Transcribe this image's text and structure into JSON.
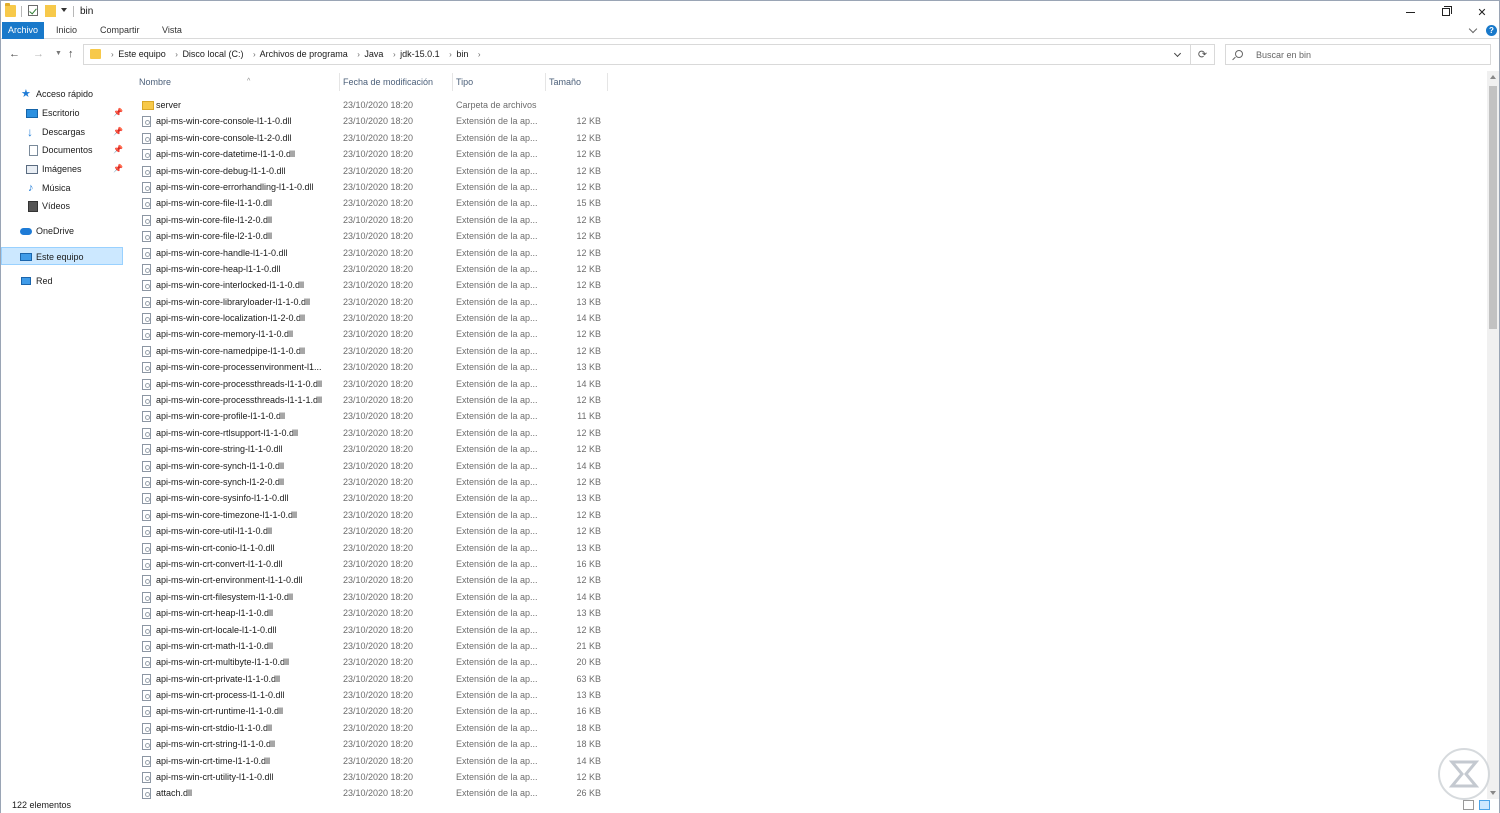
{
  "window": {
    "title": "bin"
  },
  "ribbon": {
    "tabs": [
      "Archivo",
      "Inicio",
      "Compartir",
      "Vista"
    ],
    "help_label": "?"
  },
  "address": {
    "crumbs": [
      "Este equipo",
      "Disco local (C:)",
      "Archivos de programa",
      "Java",
      "jdk-15.0.1",
      "bin"
    ],
    "search_placeholder": "Buscar en bin"
  },
  "nav_pane": {
    "items": [
      {
        "label": "Acceso rápido",
        "icon": "star-icon"
      },
      {
        "label": "Escritorio",
        "icon": "desktop-icon",
        "pinned": true
      },
      {
        "label": "Descargas",
        "icon": "download-icon",
        "pinned": true
      },
      {
        "label": "Documentos",
        "icon": "document-icon",
        "pinned": true
      },
      {
        "label": "Imágenes",
        "icon": "images-icon",
        "pinned": true
      },
      {
        "label": "Música",
        "icon": "music-icon"
      },
      {
        "label": "Vídeos",
        "icon": "video-icon"
      },
      {
        "label": "OneDrive",
        "icon": "cloud-icon"
      },
      {
        "label": "Este equipo",
        "icon": "computer-icon",
        "selected": true
      },
      {
        "label": "Red",
        "icon": "network-icon"
      }
    ]
  },
  "columns": {
    "name": "Nombre",
    "date": "Fecha de modificación",
    "type": "Tipo",
    "size": "Tamaño"
  },
  "files": [
    {
      "name": "server",
      "date": "23/10/2020 18:20",
      "type": "Carpeta de archivos",
      "size": "",
      "folder": true
    },
    {
      "name": "api-ms-win-core-console-l1-1-0.dll",
      "date": "23/10/2020 18:20",
      "type": "Extensión de la ap...",
      "size": "12 KB"
    },
    {
      "name": "api-ms-win-core-console-l1-2-0.dll",
      "date": "23/10/2020 18:20",
      "type": "Extensión de la ap...",
      "size": "12 KB"
    },
    {
      "name": "api-ms-win-core-datetime-l1-1-0.dll",
      "date": "23/10/2020 18:20",
      "type": "Extensión de la ap...",
      "size": "12 KB"
    },
    {
      "name": "api-ms-win-core-debug-l1-1-0.dll",
      "date": "23/10/2020 18:20",
      "type": "Extensión de la ap...",
      "size": "12 KB"
    },
    {
      "name": "api-ms-win-core-errorhandling-l1-1-0.dll",
      "date": "23/10/2020 18:20",
      "type": "Extensión de la ap...",
      "size": "12 KB"
    },
    {
      "name": "api-ms-win-core-file-l1-1-0.dll",
      "date": "23/10/2020 18:20",
      "type": "Extensión de la ap...",
      "size": "15 KB"
    },
    {
      "name": "api-ms-win-core-file-l1-2-0.dll",
      "date": "23/10/2020 18:20",
      "type": "Extensión de la ap...",
      "size": "12 KB"
    },
    {
      "name": "api-ms-win-core-file-l2-1-0.dll",
      "date": "23/10/2020 18:20",
      "type": "Extensión de la ap...",
      "size": "12 KB"
    },
    {
      "name": "api-ms-win-core-handle-l1-1-0.dll",
      "date": "23/10/2020 18:20",
      "type": "Extensión de la ap...",
      "size": "12 KB"
    },
    {
      "name": "api-ms-win-core-heap-l1-1-0.dll",
      "date": "23/10/2020 18:20",
      "type": "Extensión de la ap...",
      "size": "12 KB"
    },
    {
      "name": "api-ms-win-core-interlocked-l1-1-0.dll",
      "date": "23/10/2020 18:20",
      "type": "Extensión de la ap...",
      "size": "12 KB"
    },
    {
      "name": "api-ms-win-core-libraryloader-l1-1-0.dll",
      "date": "23/10/2020 18:20",
      "type": "Extensión de la ap...",
      "size": "13 KB"
    },
    {
      "name": "api-ms-win-core-localization-l1-2-0.dll",
      "date": "23/10/2020 18:20",
      "type": "Extensión de la ap...",
      "size": "14 KB"
    },
    {
      "name": "api-ms-win-core-memory-l1-1-0.dll",
      "date": "23/10/2020 18:20",
      "type": "Extensión de la ap...",
      "size": "12 KB"
    },
    {
      "name": "api-ms-win-core-namedpipe-l1-1-0.dll",
      "date": "23/10/2020 18:20",
      "type": "Extensión de la ap...",
      "size": "12 KB"
    },
    {
      "name": "api-ms-win-core-processenvironment-l1...",
      "date": "23/10/2020 18:20",
      "type": "Extensión de la ap...",
      "size": "13 KB"
    },
    {
      "name": "api-ms-win-core-processthreads-l1-1-0.dll",
      "date": "23/10/2020 18:20",
      "type": "Extensión de la ap...",
      "size": "14 KB"
    },
    {
      "name": "api-ms-win-core-processthreads-l1-1-1.dll",
      "date": "23/10/2020 18:20",
      "type": "Extensión de la ap...",
      "size": "12 KB"
    },
    {
      "name": "api-ms-win-core-profile-l1-1-0.dll",
      "date": "23/10/2020 18:20",
      "type": "Extensión de la ap...",
      "size": "11 KB"
    },
    {
      "name": "api-ms-win-core-rtlsupport-l1-1-0.dll",
      "date": "23/10/2020 18:20",
      "type": "Extensión de la ap...",
      "size": "12 KB"
    },
    {
      "name": "api-ms-win-core-string-l1-1-0.dll",
      "date": "23/10/2020 18:20",
      "type": "Extensión de la ap...",
      "size": "12 KB"
    },
    {
      "name": "api-ms-win-core-synch-l1-1-0.dll",
      "date": "23/10/2020 18:20",
      "type": "Extensión de la ap...",
      "size": "14 KB"
    },
    {
      "name": "api-ms-win-core-synch-l1-2-0.dll",
      "date": "23/10/2020 18:20",
      "type": "Extensión de la ap...",
      "size": "12 KB"
    },
    {
      "name": "api-ms-win-core-sysinfo-l1-1-0.dll",
      "date": "23/10/2020 18:20",
      "type": "Extensión de la ap...",
      "size": "13 KB"
    },
    {
      "name": "api-ms-win-core-timezone-l1-1-0.dll",
      "date": "23/10/2020 18:20",
      "type": "Extensión de la ap...",
      "size": "12 KB"
    },
    {
      "name": "api-ms-win-core-util-l1-1-0.dll",
      "date": "23/10/2020 18:20",
      "type": "Extensión de la ap...",
      "size": "12 KB"
    },
    {
      "name": "api-ms-win-crt-conio-l1-1-0.dll",
      "date": "23/10/2020 18:20",
      "type": "Extensión de la ap...",
      "size": "13 KB"
    },
    {
      "name": "api-ms-win-crt-convert-l1-1-0.dll",
      "date": "23/10/2020 18:20",
      "type": "Extensión de la ap...",
      "size": "16 KB"
    },
    {
      "name": "api-ms-win-crt-environment-l1-1-0.dll",
      "date": "23/10/2020 18:20",
      "type": "Extensión de la ap...",
      "size": "12 KB"
    },
    {
      "name": "api-ms-win-crt-filesystem-l1-1-0.dll",
      "date": "23/10/2020 18:20",
      "type": "Extensión de la ap...",
      "size": "14 KB"
    },
    {
      "name": "api-ms-win-crt-heap-l1-1-0.dll",
      "date": "23/10/2020 18:20",
      "type": "Extensión de la ap...",
      "size": "13 KB"
    },
    {
      "name": "api-ms-win-crt-locale-l1-1-0.dll",
      "date": "23/10/2020 18:20",
      "type": "Extensión de la ap...",
      "size": "12 KB"
    },
    {
      "name": "api-ms-win-crt-math-l1-1-0.dll",
      "date": "23/10/2020 18:20",
      "type": "Extensión de la ap...",
      "size": "21 KB"
    },
    {
      "name": "api-ms-win-crt-multibyte-l1-1-0.dll",
      "date": "23/10/2020 18:20",
      "type": "Extensión de la ap...",
      "size": "20 KB"
    },
    {
      "name": "api-ms-win-crt-private-l1-1-0.dll",
      "date": "23/10/2020 18:20",
      "type": "Extensión de la ap...",
      "size": "63 KB"
    },
    {
      "name": "api-ms-win-crt-process-l1-1-0.dll",
      "date": "23/10/2020 18:20",
      "type": "Extensión de la ap...",
      "size": "13 KB"
    },
    {
      "name": "api-ms-win-crt-runtime-l1-1-0.dll",
      "date": "23/10/2020 18:20",
      "type": "Extensión de la ap...",
      "size": "16 KB"
    },
    {
      "name": "api-ms-win-crt-stdio-l1-1-0.dll",
      "date": "23/10/2020 18:20",
      "type": "Extensión de la ap...",
      "size": "18 KB"
    },
    {
      "name": "api-ms-win-crt-string-l1-1-0.dll",
      "date": "23/10/2020 18:20",
      "type": "Extensión de la ap...",
      "size": "18 KB"
    },
    {
      "name": "api-ms-win-crt-time-l1-1-0.dll",
      "date": "23/10/2020 18:20",
      "type": "Extensión de la ap...",
      "size": "14 KB"
    },
    {
      "name": "api-ms-win-crt-utility-l1-1-0.dll",
      "date": "23/10/2020 18:20",
      "type": "Extensión de la ap...",
      "size": "12 KB"
    },
    {
      "name": "attach.dll",
      "date": "23/10/2020 18:20",
      "type": "Extensión de la ap...",
      "size": "26 KB"
    }
  ],
  "status": {
    "count": "122 elementos"
  },
  "colors": {
    "accent": "#1979ca",
    "selection": "#cce8ff",
    "header_text": "#4c607a"
  }
}
